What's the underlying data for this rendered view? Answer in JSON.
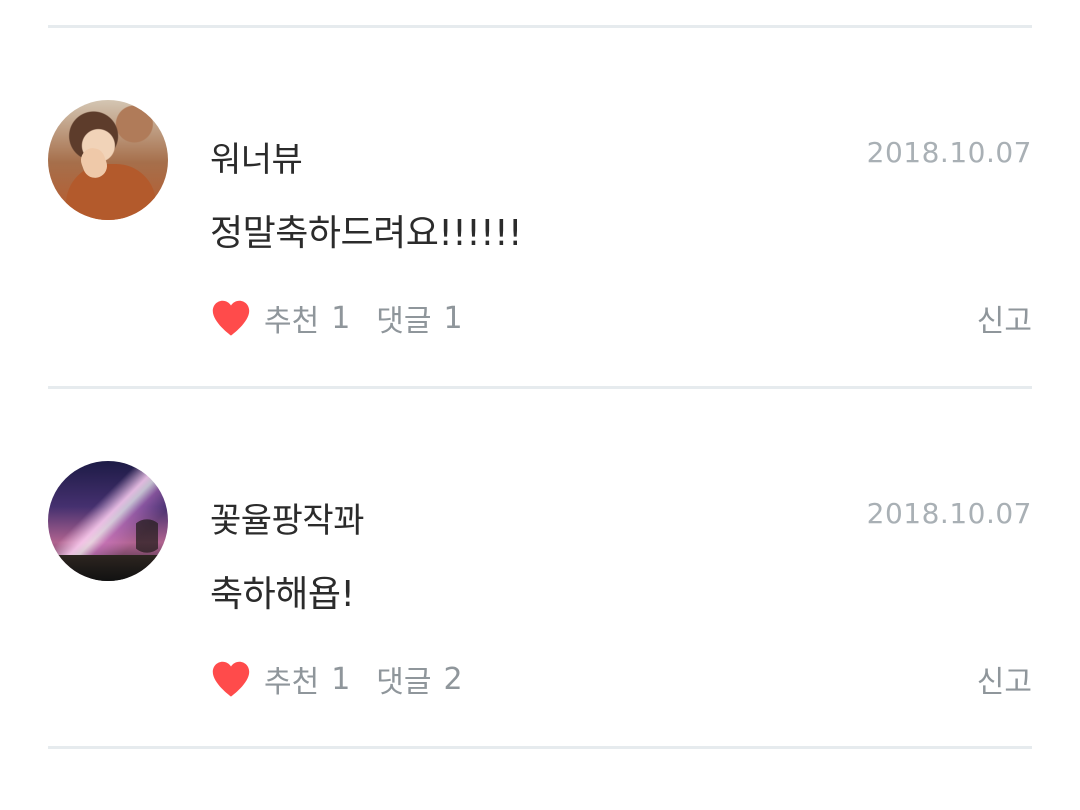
{
  "comments": [
    {
      "username": "워너뷰",
      "date": "2018.10.07",
      "text": "정말축하드려요!!!!!!",
      "like_label": "추천",
      "like_count": "1",
      "reply_label": "댓글",
      "reply_count": "1",
      "report_label": "신고",
      "avatar_icon": "profile-photo-person"
    },
    {
      "username": "꽃율팡작꽈",
      "date": "2018.10.07",
      "text": "축하해욥!",
      "like_label": "추천",
      "like_count": "1",
      "reply_label": "댓글",
      "reply_count": "2",
      "report_label": "신고",
      "avatar_icon": "profile-photo-night-sky"
    }
  ],
  "colors": {
    "heart": "#ff4b4b",
    "text_primary": "#2b2b2b",
    "text_secondary": "#8f969b",
    "date": "#a9b0b5",
    "divider": "#e6ebee"
  }
}
